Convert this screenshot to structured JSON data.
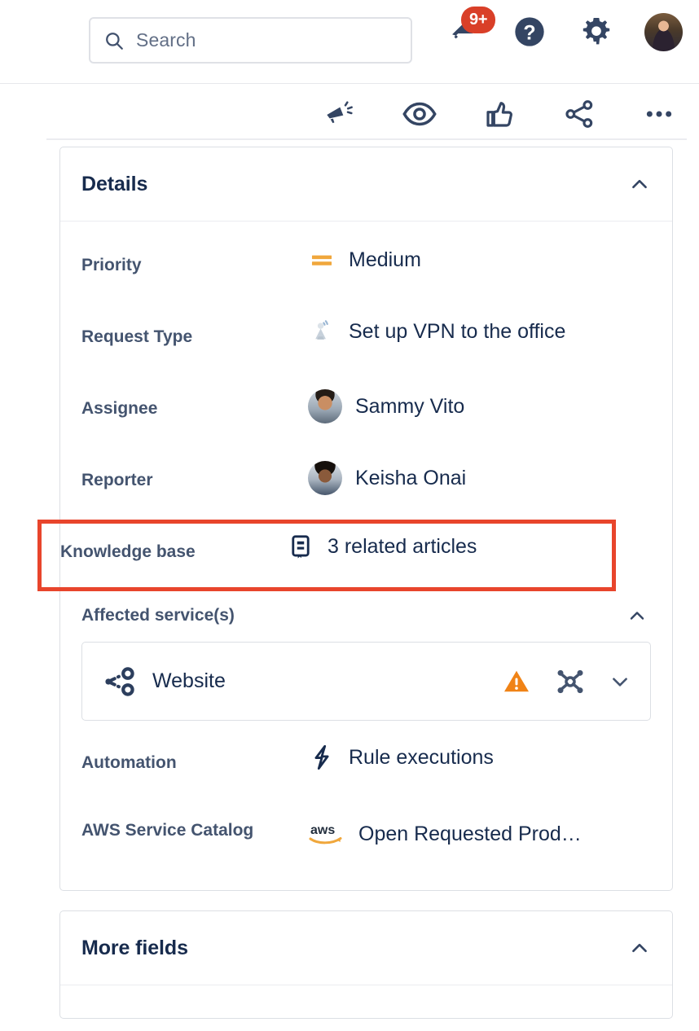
{
  "header": {
    "search": {
      "placeholder": "Search",
      "icon": "search-icon"
    },
    "notifications": {
      "icon": "notification-bell-icon",
      "badge": "9+"
    },
    "help": {
      "icon": "help-circle-icon"
    },
    "settings": {
      "icon": "gear-icon"
    },
    "profile": {
      "icon": "avatar"
    }
  },
  "toolbar": {
    "items": [
      {
        "icon": "megaphone-icon",
        "name": "feedback-button"
      },
      {
        "icon": "eye-icon",
        "name": "watch-button"
      },
      {
        "icon": "thumbs-up-icon",
        "name": "like-button"
      },
      {
        "icon": "share-icon",
        "name": "share-button"
      },
      {
        "icon": "more-ellipsis-icon",
        "name": "more-actions-button"
      }
    ]
  },
  "details_panel": {
    "title": "Details",
    "collapse_icon": "chevron-up-icon",
    "fields": [
      {
        "label": "Priority",
        "value": "Medium",
        "icon": "priority-medium-icon"
      },
      {
        "label": "Request Type",
        "value": "Set up VPN to the office",
        "icon": "vpn-satellite-icon"
      },
      {
        "label": "Assignee",
        "value": "Sammy Vito",
        "icon": "user-avatar"
      },
      {
        "label": "Reporter",
        "value": "Keisha Onai",
        "icon": "user-avatar"
      },
      {
        "label": "Knowledge base",
        "value": "3 related articles",
        "icon": "knowledge-base-book-icon",
        "highlighted": true
      }
    ],
    "affected_services": {
      "label": "Affected service(s)",
      "collapse_icon": "chevron-up-icon",
      "service": {
        "name": "Website",
        "icon": "service-node-icon",
        "status_icon": "warning-triangle-icon",
        "topology_icon": "topology-graph-icon",
        "expand_icon": "chevron-down-icon"
      }
    },
    "extra_fields": [
      {
        "label": "Automation",
        "value": "Rule executions",
        "icon": "lightning-bolt-icon"
      },
      {
        "label": "AWS Service Catalog",
        "value": "Open Requested Prod…",
        "icon": "aws-logo-icon"
      }
    ]
  },
  "more_fields_panel": {
    "title": "More fields",
    "collapse_icon": "chevron-up-icon"
  },
  "colors": {
    "highlight_border": "#E8452C",
    "badge_red": "#D93F28",
    "priority_orange": "#F0A73C",
    "warning_orange": "#F08316",
    "text_dark": "#172B4D",
    "label_gray": "#44546F",
    "border_gray": "#DCDFE4"
  }
}
